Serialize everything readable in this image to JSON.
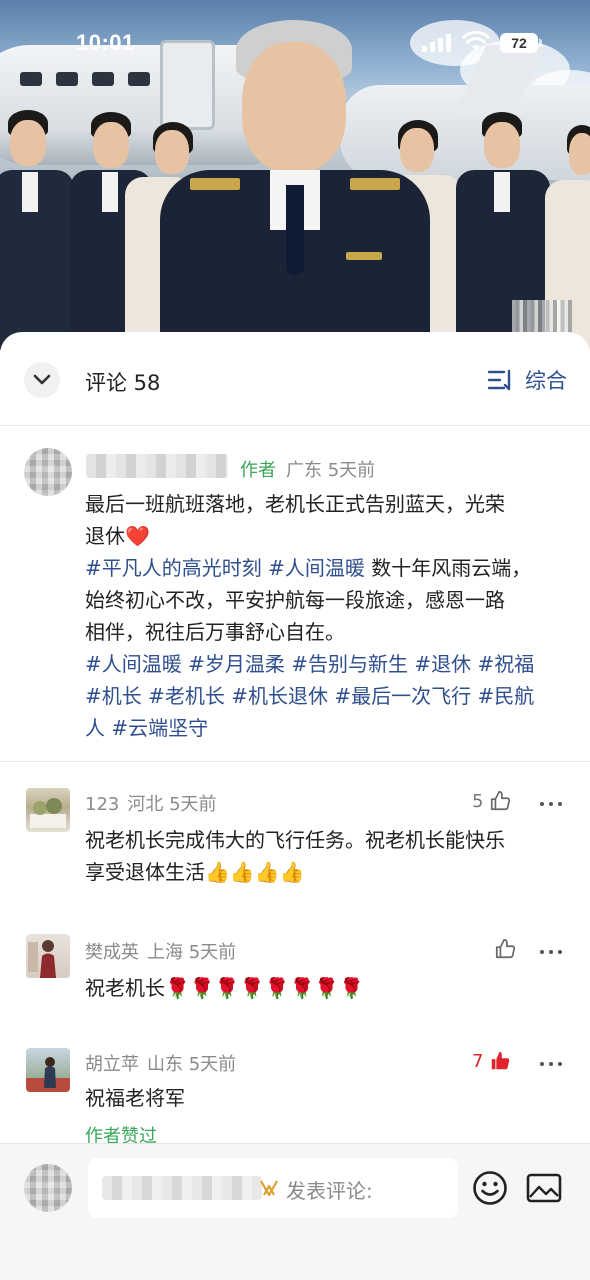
{
  "status_bar": {
    "time": "10:01",
    "battery": "72"
  },
  "comments_header": {
    "title": "评论 58",
    "sort_label": "综合"
  },
  "post": {
    "author_tag": "作者",
    "location": "广东",
    "time": "5天前",
    "lines": [
      "最后一班航班落地，老机长正式告别蓝天，光荣",
      "退休"
    ],
    "heart": "❤️",
    "tag_line_1_tags": "#平凡人的高光时刻 #人间温暖",
    "tag_line_1_text": " 数十年风雨云端，",
    "body_lines": [
      "始终初心不改，平安护航每一段旅途，感恩一路",
      "相伴，祝往后万事舒心自在。"
    ],
    "tag_lines": [
      "#人间温暖 #岁月温柔 #告别与新生 #退休 #祝福",
      "#机长 #老机长 #机长退休 #最后一次飞行 #民航",
      "人 #云端坚守"
    ]
  },
  "comments": [
    {
      "user": "123",
      "location": "河北",
      "time": "5天前",
      "likes": "5",
      "lines": [
        "祝老机长完成伟大的飞行任务。祝老机长能快乐",
        "享受退体生活👍👍👍👍"
      ]
    },
    {
      "user": "樊成英",
      "location": "上海",
      "time": "5天前",
      "likes": "",
      "lines": [
        "祝老机长🌹🌹🌹🌹🌹🌹🌹🌹"
      ]
    },
    {
      "user": "胡立苹",
      "location": "山东",
      "time": "5天前",
      "likes": "7",
      "lines": [
        "祝福老将军"
      ],
      "author_liked": "作者赞过"
    }
  ],
  "input": {
    "placeholder": "发表评论:"
  },
  "icons": {
    "collapse": "chevron-down-icon",
    "sort": "sort-icon",
    "like": "thumbs-up-icon",
    "more": "more-icon",
    "emoji": "emoji-icon",
    "image": "image-icon"
  },
  "colors": {
    "accent_blue": "#2f4f8f",
    "author_green": "#3aa65a",
    "like_red": "#e0242c"
  }
}
